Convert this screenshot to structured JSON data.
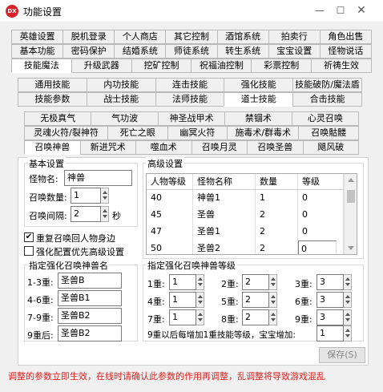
{
  "window": {
    "title": "功能设置",
    "icon": "dx-app-icon",
    "minimize_icon": "minimize-icon",
    "maximize_icon": "maximize-icon",
    "close_icon": "close-icon"
  },
  "tabs_row1": [
    "英雄设置",
    "脱机登录",
    "个人商店",
    "其它控制",
    "酒馆系统",
    "拍卖行",
    "角色出售"
  ],
  "tabs_row2": [
    "基本功能",
    "密码保护",
    "结婚系统",
    "师徒系统",
    "转生系统",
    "宝宝设置",
    "怪物说话"
  ],
  "tabs_row3": [
    "技能魔法",
    "升级武器",
    "挖矿控制",
    "祝福油控制",
    "彩票控制",
    "祈祷生效"
  ],
  "subtabs_row1": [
    "通用技能",
    "内功技能",
    "连击技能",
    "强化技能",
    "技能破防/魔法盾"
  ],
  "subtabs_row2": [
    "技能参数",
    "战士技能",
    "法师技能",
    "道士技能",
    "合击技能"
  ],
  "taoist_row1": [
    "无极真气",
    "气功波",
    "神圣战甲术",
    "禁锢术",
    "心灵召唤"
  ],
  "taoist_row2": [
    "灵魂火符/裂神符",
    "死亡之眼",
    "幽冥火符",
    "施毒术/群毒术",
    "召唤骷髅"
  ],
  "taoist_row3": [
    "召唤神兽",
    "新进咒术",
    "噬血术",
    "召唤月灵",
    "召唤圣兽",
    "飓风破"
  ],
  "basic": {
    "group_title": "基本设置",
    "monster_label": "怪物名:",
    "monster_value": "神兽",
    "count_label": "召唤数量:",
    "count_value": "1",
    "interval_label": "召唤间隔:",
    "interval_value": "2",
    "interval_unit": "秒"
  },
  "checks": {
    "redo_label": "重复召唤回人物身边",
    "redo_checked": "✔",
    "priority_label": "强化配置优先高级设置",
    "priority_checked": ""
  },
  "adv": {
    "group_title": "高级设置",
    "headers": [
      "人物等级",
      "怪物名称",
      "数量",
      "等级"
    ],
    "rows": [
      [
        "40",
        "神兽1",
        "1",
        "0"
      ],
      [
        "45",
        "圣兽",
        "2",
        "0"
      ],
      [
        "47",
        "圣兽1",
        "2",
        "0"
      ],
      [
        "50",
        "圣兽2",
        "2",
        "0"
      ]
    ]
  },
  "names": {
    "group_title": "指定强化召唤神兽名",
    "rows": [
      [
        "1-3重:",
        "圣兽B"
      ],
      [
        "4-6重:",
        "圣兽B1"
      ],
      [
        "7-9重:",
        "圣兽B2"
      ],
      [
        "9重后:",
        "圣兽B2"
      ]
    ]
  },
  "levels": {
    "group_title": "指定强化召唤神兽等级",
    "rows": [
      [
        [
          "1重:",
          "1"
        ],
        [
          "2重:",
          "2"
        ],
        [
          "3重:",
          "3"
        ]
      ],
      [
        [
          "4重:",
          "1"
        ],
        [
          "5重:",
          "2"
        ],
        [
          "6重:",
          "3"
        ]
      ],
      [
        [
          "7重:",
          "1"
        ],
        [
          "8重:",
          "2"
        ],
        [
          "9重:",
          "3"
        ]
      ]
    ],
    "extra_label": "9重以后每增加1重技能等级，宝宝增加:",
    "extra_value": "1"
  },
  "save_button": "保存(S)",
  "warning": "调整的参数立即生效，在线时请确认此参数的作用再调整，乱调整将导致游戏混乱"
}
